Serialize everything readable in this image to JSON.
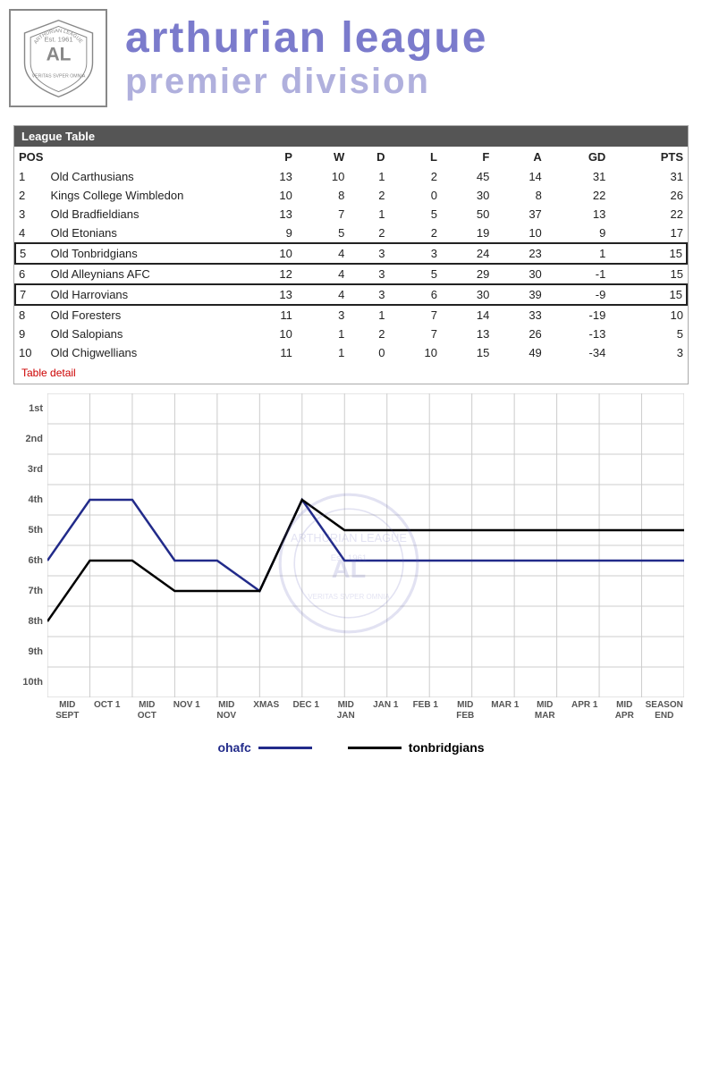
{
  "header": {
    "title_line1": "arthurian league",
    "title_line2": "premier division"
  },
  "table_section": {
    "header": "League Table",
    "columns": [
      "POS",
      "",
      "P",
      "W",
      "D",
      "L",
      "F",
      "A",
      "GD",
      "PTS"
    ],
    "rows": [
      {
        "pos": "1",
        "name": "Old Carthusians",
        "p": "13",
        "w": "10",
        "d": "1",
        "l": "2",
        "f": "45",
        "a": "14",
        "gd": "31",
        "pts": "31",
        "bordered": false
      },
      {
        "pos": "2",
        "name": "Kings College Wimbledon",
        "p": "10",
        "w": "8",
        "d": "2",
        "l": "0",
        "f": "30",
        "a": "8",
        "gd": "22",
        "pts": "26",
        "bordered": false
      },
      {
        "pos": "3",
        "name": "Old Bradfieldians",
        "p": "13",
        "w": "7",
        "d": "1",
        "l": "5",
        "f": "50",
        "a": "37",
        "gd": "13",
        "pts": "22",
        "bordered": false
      },
      {
        "pos": "4",
        "name": "Old Etonians",
        "p": "9",
        "w": "5",
        "d": "2",
        "l": "2",
        "f": "19",
        "a": "10",
        "gd": "9",
        "pts": "17",
        "bordered": false
      },
      {
        "pos": "5",
        "name": "Old Tonbridgians",
        "p": "10",
        "w": "4",
        "d": "3",
        "l": "3",
        "f": "24",
        "a": "23",
        "gd": "1",
        "pts": "15",
        "bordered": true
      },
      {
        "pos": "6",
        "name": "Old Alleynians AFC",
        "p": "12",
        "w": "4",
        "d": "3",
        "l": "5",
        "f": "29",
        "a": "30",
        "gd": "-1",
        "pts": "15",
        "bordered": false
      },
      {
        "pos": "7",
        "name": "Old Harrovians",
        "p": "13",
        "w": "4",
        "d": "3",
        "l": "6",
        "f": "30",
        "a": "39",
        "gd": "-9",
        "pts": "15",
        "bordered": true
      },
      {
        "pos": "8",
        "name": "Old Foresters",
        "p": "11",
        "w": "3",
        "d": "1",
        "l": "7",
        "f": "14",
        "a": "33",
        "gd": "-19",
        "pts": "10",
        "bordered": false
      },
      {
        "pos": "9",
        "name": "Old Salopians",
        "p": "10",
        "w": "1",
        "d": "2",
        "l": "7",
        "f": "13",
        "a": "26",
        "gd": "-13",
        "pts": "5",
        "bordered": false
      },
      {
        "pos": "10",
        "name": "Old Chigwellians",
        "p": "11",
        "w": "1",
        "d": "0",
        "l": "10",
        "f": "15",
        "a": "49",
        "gd": "-34",
        "pts": "3",
        "bordered": false
      }
    ],
    "table_detail_link": "Table detail"
  },
  "chart": {
    "y_labels": [
      "1st",
      "2nd",
      "3rd",
      "4th",
      "5th",
      "6th",
      "7th",
      "8th",
      "9th",
      "10th"
    ],
    "x_labels": [
      {
        "top": "MID",
        "bottom": "SEPT"
      },
      {
        "top": "OCT 1",
        "bottom": ""
      },
      {
        "top": "MID",
        "bottom": "OCT"
      },
      {
        "top": "NOV 1",
        "bottom": ""
      },
      {
        "top": "MID",
        "bottom": "NOV"
      },
      {
        "top": "XMAS",
        "bottom": ""
      },
      {
        "top": "DEC 1",
        "bottom": ""
      },
      {
        "top": "MID",
        "bottom": "JAN"
      },
      {
        "top": "JAN 1",
        "bottom": ""
      },
      {
        "top": "FEB 1",
        "bottom": ""
      },
      {
        "top": "MID",
        "bottom": "FEB"
      },
      {
        "top": "MAR 1",
        "bottom": ""
      },
      {
        "top": "MID",
        "bottom": "MAR"
      },
      {
        "top": "APR 1",
        "bottom": ""
      },
      {
        "top": "MID",
        "bottom": "APR"
      },
      {
        "top": "SEASON",
        "bottom": "END"
      }
    ],
    "series_ohafc": {
      "label": "ohafc",
      "color": "#222b8a",
      "points": [
        6,
        4,
        4,
        6,
        6,
        7,
        4,
        6,
        6,
        6,
        6,
        6,
        6,
        6,
        6,
        6
      ]
    },
    "series_tonbridgians": {
      "label": "tonbridgians",
      "color": "#000000",
      "points": [
        8,
        6,
        6,
        7,
        7,
        7,
        4,
        5,
        5,
        5,
        5,
        5,
        5,
        5,
        5,
        5
      ]
    }
  },
  "legend": {
    "ohafc_label": "ohafc",
    "tonbridgians_label": "tonbridgians"
  }
}
